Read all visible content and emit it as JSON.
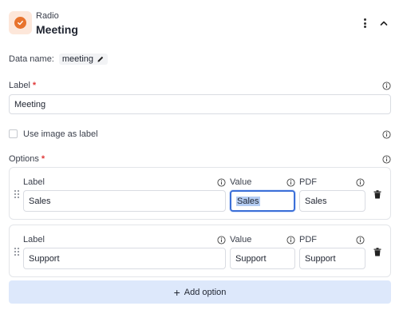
{
  "header": {
    "type_label": "Radio",
    "title": "Meeting",
    "icons": {
      "badge": "check-circle-icon",
      "menu": "more-vertical-icon",
      "collapse": "chevron-up-icon"
    },
    "colors": {
      "badge_bg": "#fde7da",
      "badge_accent": "#e8732d"
    }
  },
  "data_name": {
    "label": "Data name:",
    "value": "meeting",
    "edit_icon": "pencil-icon"
  },
  "label_field": {
    "label": "Label",
    "required_mark": "*",
    "value": "Meeting",
    "info_icon": "info-icon"
  },
  "use_image": {
    "label": "Use image as label",
    "checked": false,
    "info_icon": "info-icon"
  },
  "options_section": {
    "label": "Options",
    "required_mark": "*",
    "info_icon": "info-icon",
    "column_headers": {
      "label": "Label",
      "value": "Value",
      "pdf": "PDF"
    },
    "options": [
      {
        "label": "Sales",
        "value": "Sales",
        "pdf": "Sales",
        "value_focused": true
      },
      {
        "label": "Support",
        "value": "Support",
        "pdf": "Support",
        "value_focused": false
      }
    ],
    "delete_icon": "trash-icon",
    "drag_icon": "drag-handle-icon"
  },
  "add_option": {
    "label": "Add option",
    "icon": "plus-icon",
    "color": "#dde8fb"
  },
  "accent_color": "#3b6fd8",
  "required_color": "#e03a3a"
}
